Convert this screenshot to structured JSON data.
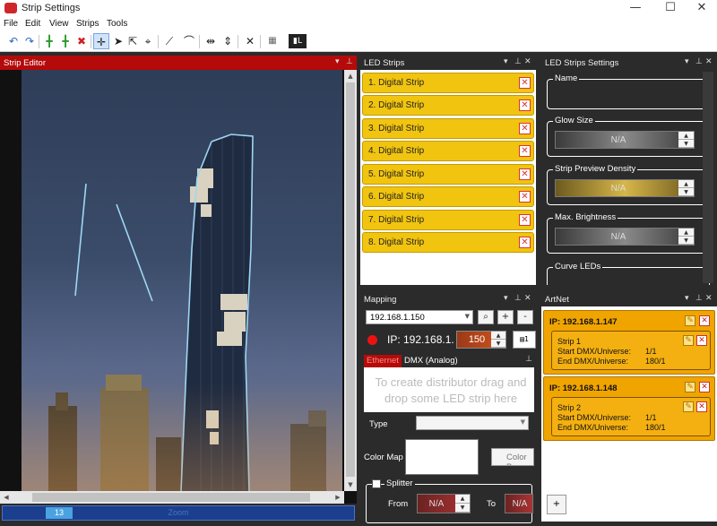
{
  "window": {
    "title": "Strip Settings",
    "minimize": "—",
    "maximize": "☐",
    "close": "✕"
  },
  "menu": [
    "File",
    "Edit",
    "View",
    "Strips",
    "Tools"
  ],
  "toolbar_icons": [
    "undo-icon",
    "redo-icon",
    "add-strip-icon",
    "add-strip-alt-icon",
    "delete-strip-icon",
    "crosshair-icon",
    "pointer-icon",
    "select-icon",
    "node-select-icon",
    "line-icon",
    "curve-icon",
    "split-vertical-icon",
    "split-horizontal-icon",
    "clear-icon",
    "grid-icon",
    "preview-icon"
  ],
  "strip_editor": {
    "title": "Strip Editor",
    "zoom_value": "13",
    "zoom_label": "Zoom"
  },
  "led_strips": {
    "title": "LED Strips",
    "items": [
      "1. Digital Strip",
      "2. Digital Strip",
      "3. Digital Strip",
      "4. Digital Strip",
      "5. Digital Strip",
      "6. Digital Strip",
      "7. Digital Strip",
      "8. Digital Strip"
    ]
  },
  "settings": {
    "title": "LED Strips Settings",
    "name_label": "Name",
    "glow_size_label": "Glow Size",
    "glow_size_value": "N/A",
    "density_label": "Strip Preview Density",
    "density_value": "N/A",
    "brightness_label": "Max. Brightness",
    "brightness_value": "N/A",
    "curve_label": "Curve LEDs"
  },
  "mapping": {
    "title": "Mapping",
    "ip_select": "192.168.1.150",
    "ip_label": "IP: 192.168.1.",
    "ip_last_octet": "150",
    "tab_ethernet": "Ethernet",
    "tab_dmx": "DMX (Analog)",
    "drop_hint": "To create distributor drag and drop some LED strip here",
    "type_label": "Type",
    "color_map_label": "Color Map",
    "color_button": "Color B",
    "splitter_label": "Splitter",
    "from_label": "From",
    "from_value": "N/A",
    "to_label": "To",
    "to_value": "N/A"
  },
  "artnet": {
    "title": "ArtNet",
    "devices": [
      {
        "ip": "IP: 192.168.1.147",
        "strip": {
          "name": "Strip 1",
          "start_label": "Start DMX/Universe:",
          "start_value": "1/1",
          "end_label": "End DMX/Universe:",
          "end_value": "180/1"
        }
      },
      {
        "ip": "IP: 192.168.1.148",
        "strip": {
          "name": "Strip 2",
          "start_label": "Start DMX/Universe:",
          "start_value": "1/1",
          "end_label": "End DMX/Universe:",
          "end_value": "180/1"
        }
      }
    ],
    "add_label": "+"
  },
  "colors": {
    "editor_header": "#b40a0a",
    "strip_item": "#f1c40f",
    "artnet_card": "#f0a400",
    "strip_outline": "#9fd6f2"
  }
}
